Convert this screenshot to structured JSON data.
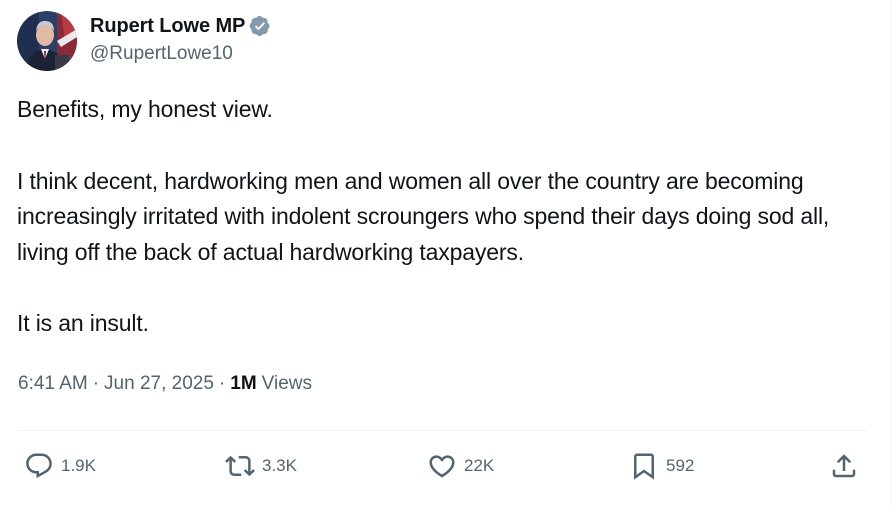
{
  "author": {
    "display_name": "Rupert Lowe MP",
    "handle": "@RupertLowe10",
    "verified_badge_icon": "verified-badge-icon",
    "verified_badge_color": "#829aab"
  },
  "tweet": {
    "paragraphs": [
      "Benefits, my honest view.",
      "I think decent, hardworking men and women all over the country are becoming increasingly irritated with indolent scroungers who spend their days doing sod all, living off the back of actual hardworking taxpayers.",
      "It is an insult."
    ]
  },
  "meta": {
    "time": "6:41 AM",
    "separator": "·",
    "date": "Jun 27, 2025",
    "views_count": "1M",
    "views_label": "Views"
  },
  "actions": {
    "reply": {
      "icon": "reply-icon",
      "count": "1.9K"
    },
    "repost": {
      "icon": "repost-icon",
      "count": "3.3K"
    },
    "like": {
      "icon": "like-icon",
      "count": "22K"
    },
    "bookmark": {
      "icon": "bookmark-icon",
      "count": "592"
    },
    "share": {
      "icon": "share-icon"
    }
  },
  "colors": {
    "text_primary": "#0f1419",
    "text_secondary": "#536471",
    "divider": "#eff3f4"
  }
}
